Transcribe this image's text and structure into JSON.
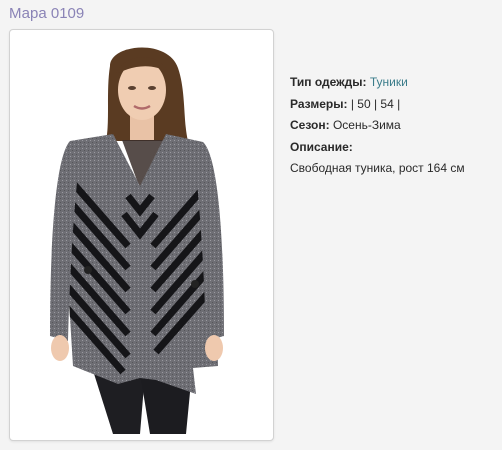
{
  "product": {
    "title": "Мара 0109",
    "image_alt": "Мара 0109 — модель в тунике"
  },
  "details": {
    "type_label": "Тип одежды:",
    "type_value": "Туники",
    "sizes_label": "Размеры:",
    "sizes_value": "| 50 | 54 |",
    "season_label": "Сезон:",
    "season_value": "Осень-Зима",
    "description_label": "Описание:",
    "description_value": "Свободная туника, рост 164 см"
  },
  "colors": {
    "title": "#8a83b6",
    "link": "#3a7c8a"
  }
}
